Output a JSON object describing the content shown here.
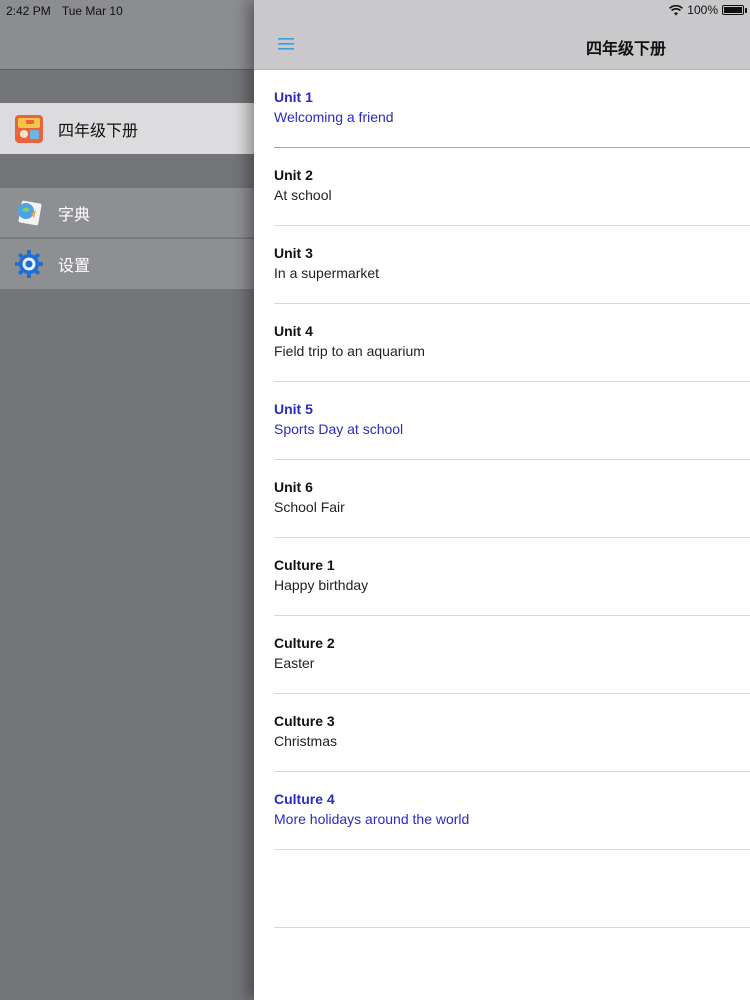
{
  "status": {
    "time": "2:42 PM",
    "date": "Tue Mar 10",
    "battery": "100%",
    "battery_level": 1.0
  },
  "sidebar": {
    "items": [
      {
        "label": "四年级下册",
        "icon": "book-cover-icon"
      },
      {
        "label": "字典",
        "icon": "dictionary-icon"
      },
      {
        "label": "设置",
        "icon": "gear-icon"
      }
    ]
  },
  "nav": {
    "title": "四年级下册",
    "menu_icon": "hamburger-menu-icon"
  },
  "units": [
    {
      "title": "Unit 1",
      "subtitle": "Welcoming a friend",
      "highlighted": true
    },
    {
      "title": "Unit 2",
      "subtitle": "At school",
      "highlighted": false
    },
    {
      "title": "Unit 3",
      "subtitle": "In a supermarket",
      "highlighted": false
    },
    {
      "title": "Unit 4",
      "subtitle": "Field trip to an aquarium",
      "highlighted": false
    },
    {
      "title": "Unit 5",
      "subtitle": "Sports Day at school",
      "highlighted": true
    },
    {
      "title": "Unit 6",
      "subtitle": "School Fair",
      "highlighted": false
    },
    {
      "title": "Culture 1",
      "subtitle": "Happy birthday",
      "highlighted": false
    },
    {
      "title": "Culture 2",
      "subtitle": "Easter",
      "highlighted": false
    },
    {
      "title": "Culture 3",
      "subtitle": "Christmas",
      "highlighted": false
    },
    {
      "title": "Culture 4",
      "subtitle": "More holidays around the world",
      "highlighted": true
    }
  ],
  "colors": {
    "highlight": "#2a2bc2",
    "menu_icon": "#3b9de0"
  }
}
